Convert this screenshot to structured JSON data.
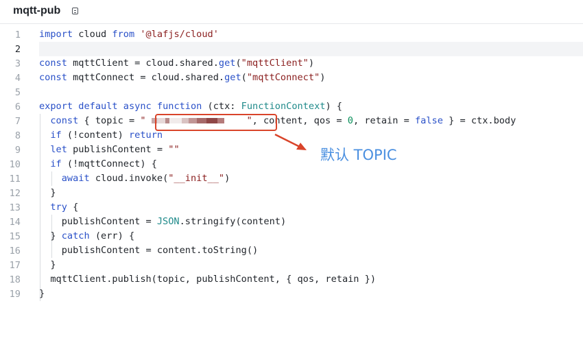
{
  "header": {
    "file_name": "mqtt-pub",
    "icon": "document-icon"
  },
  "editor": {
    "active_line": 2,
    "lines": [
      {
        "n": "1",
        "text": "import cloud from '@lafjs/cloud'"
      },
      {
        "n": "2",
        "text": ""
      },
      {
        "n": "3",
        "text": "const mqttClient = cloud.shared.get(\"mqttClient\")"
      },
      {
        "n": "4",
        "text": "const mqttConnect = cloud.shared.get(\"mqttConnect\")"
      },
      {
        "n": "5",
        "text": ""
      },
      {
        "n": "6",
        "text": "export default async function (ctx: FunctionContext) {"
      },
      {
        "n": "7",
        "text": "  const { topic = \" [redacted]\", content, qos = 0, retain = false } = ctx.body"
      },
      {
        "n": "8",
        "text": "  if (!content) return"
      },
      {
        "n": "9",
        "text": "  let publishContent = \"\""
      },
      {
        "n": "10",
        "text": "  if (!mqttConnect) {"
      },
      {
        "n": "11",
        "text": "    await cloud.invoke(\"__init__\")"
      },
      {
        "n": "12",
        "text": "  }"
      },
      {
        "n": "13",
        "text": "  try {"
      },
      {
        "n": "14",
        "text": "    publishContent = JSON.stringify(content)"
      },
      {
        "n": "15",
        "text": "  } catch (err) {"
      },
      {
        "n": "16",
        "text": "    publishContent = content.toString()"
      },
      {
        "n": "17",
        "text": "  }"
      },
      {
        "n": "18",
        "text": "  mqttClient.publish(topic, publishContent, { qos, retain })"
      },
      {
        "n": "19",
        "text": "}"
      }
    ]
  },
  "annotation": {
    "label": "默认 TOPIC",
    "color": "#d9442a",
    "label_color": "#4a8fe0"
  }
}
